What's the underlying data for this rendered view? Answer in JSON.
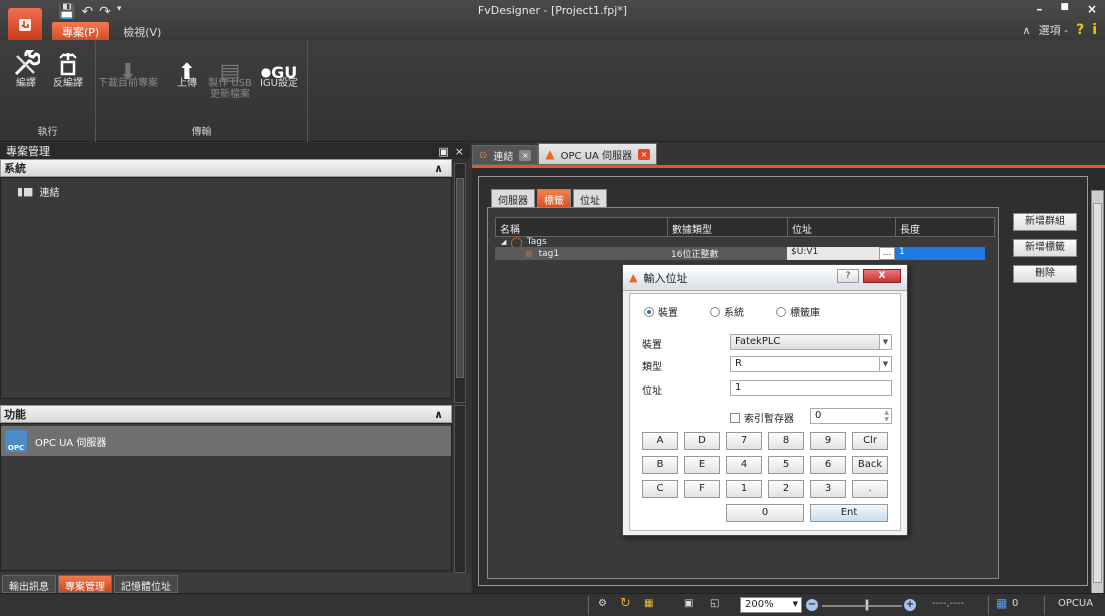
{
  "window": {
    "title": "FvDesigner - [Project1.fpj*]",
    "minimize": "–",
    "maximize": "■",
    "close": "×"
  },
  "ribbon_tabs": [
    {
      "label": "專案(P)",
      "active": true
    },
    {
      "label": "檢視(V)",
      "active": false
    }
  ],
  "options": {
    "collapse": "∧",
    "label": "選項 -",
    "help": "?",
    "info": "i"
  },
  "ribbon": {
    "group_exec": {
      "label": "執行",
      "compile": "編譯",
      "decompile": "反編譯"
    },
    "group_transfer": {
      "label": "傳輸",
      "download": "下載目前專案",
      "upload": "上傳",
      "usb_line1": "製作 USB",
      "usb_line2": "更新檔案",
      "igu_icon_text": "GU",
      "igu_settings": "IGU設定"
    }
  },
  "left_panel": {
    "title": "專案管理",
    "float_icon": "▣",
    "close_icon": "×",
    "system_section": "系統",
    "system_collapse": "∧",
    "system_items": [
      {
        "label": "連結"
      }
    ],
    "function_section": "功能",
    "function_collapse": "∧",
    "function_items": [
      {
        "label": "OPC UA 伺服器",
        "icon_text": "OPC"
      }
    ],
    "bottom_tabs": [
      {
        "label": "輸出訊息",
        "active": false
      },
      {
        "label": "專案管理",
        "active": true
      },
      {
        "label": "記憶體位址",
        "active": false
      }
    ]
  },
  "doc_tabs": [
    {
      "label": "連結",
      "active": false,
      "close": "×"
    },
    {
      "label": "OPC UA 伺服器",
      "active": true,
      "close": "×"
    }
  ],
  "inner_tabs": [
    {
      "label": "伺服器",
      "active": false
    },
    {
      "label": "標籤",
      "active": true
    },
    {
      "label": "位址",
      "active": false
    }
  ],
  "tag_grid": {
    "columns": [
      "名稱",
      "數據類型",
      "位址",
      "長度"
    ],
    "group_row": {
      "expander": "◢",
      "name": "Tags"
    },
    "rows": [
      {
        "name": "tag1",
        "type": "16位正整數",
        "address": "$U:V1",
        "browse": "...",
        "length": "1"
      }
    ]
  },
  "side_buttons": {
    "add_group": "新增群組",
    "add_tag": "新增標籤",
    "delete": "刪除"
  },
  "dialog": {
    "title": "輸入位址",
    "help": "?",
    "close": "X",
    "radio_device": "裝置",
    "radio_system": "系統",
    "radio_taglib": "標籤庫",
    "selected_radio": "device",
    "device_label": "裝置",
    "device_value": "FatekPLC",
    "type_label": "類型",
    "type_value": "R",
    "address_label": "位址",
    "address_value": "1",
    "index_register_label": "索引暫存器",
    "index_register_checked": false,
    "index_value": "0",
    "keys": [
      "A",
      "D",
      "7",
      "8",
      "9",
      "Clr",
      "B",
      "E",
      "4",
      "5",
      "6",
      "Back",
      "C",
      "F",
      "1",
      "2",
      "3",
      ".",
      "0",
      "Ent"
    ]
  },
  "statusbar": {
    "zoom": "200%",
    "zoom_minus": "−",
    "zoom_plus": "+",
    "coords": "----,----",
    "count": "0",
    "mode": "OPCUA"
  }
}
